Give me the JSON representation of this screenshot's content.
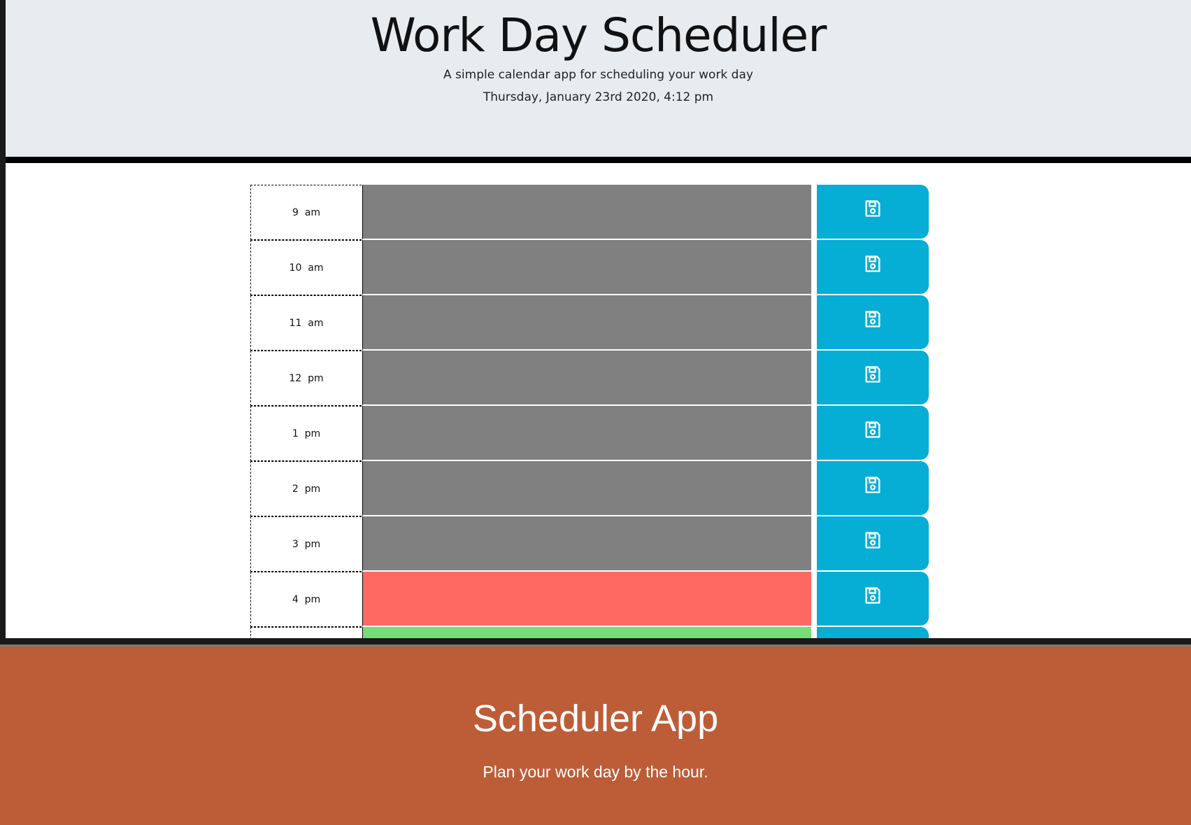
{
  "header": {
    "title": "Work Day Scheduler",
    "lead": "A simple calendar app for scheduling your work day",
    "current_day": "Thursday, January 23rd 2020, 4:12 pm"
  },
  "colors": {
    "past": "#808080",
    "present": "#ff6961",
    "future": "#77dd77",
    "save": "#06aed5",
    "banner": "#bd5d38"
  },
  "rows": [
    {
      "hour": "9  am",
      "state": "past",
      "text": ""
    },
    {
      "hour": "10  am",
      "state": "past",
      "text": ""
    },
    {
      "hour": "11  am",
      "state": "past",
      "text": ""
    },
    {
      "hour": "12  pm",
      "state": "past",
      "text": ""
    },
    {
      "hour": "1  pm",
      "state": "past",
      "text": ""
    },
    {
      "hour": "2  pm",
      "state": "past",
      "text": ""
    },
    {
      "hour": "3  pm",
      "state": "past",
      "text": ""
    },
    {
      "hour": "4  pm",
      "state": "present",
      "text": ""
    },
    {
      "hour": "",
      "state": "future",
      "text": ""
    }
  ],
  "save_icon": "floppy-disk-icon",
  "banner": {
    "title": "Scheduler App",
    "subtitle": "Plan your work day by the hour."
  }
}
